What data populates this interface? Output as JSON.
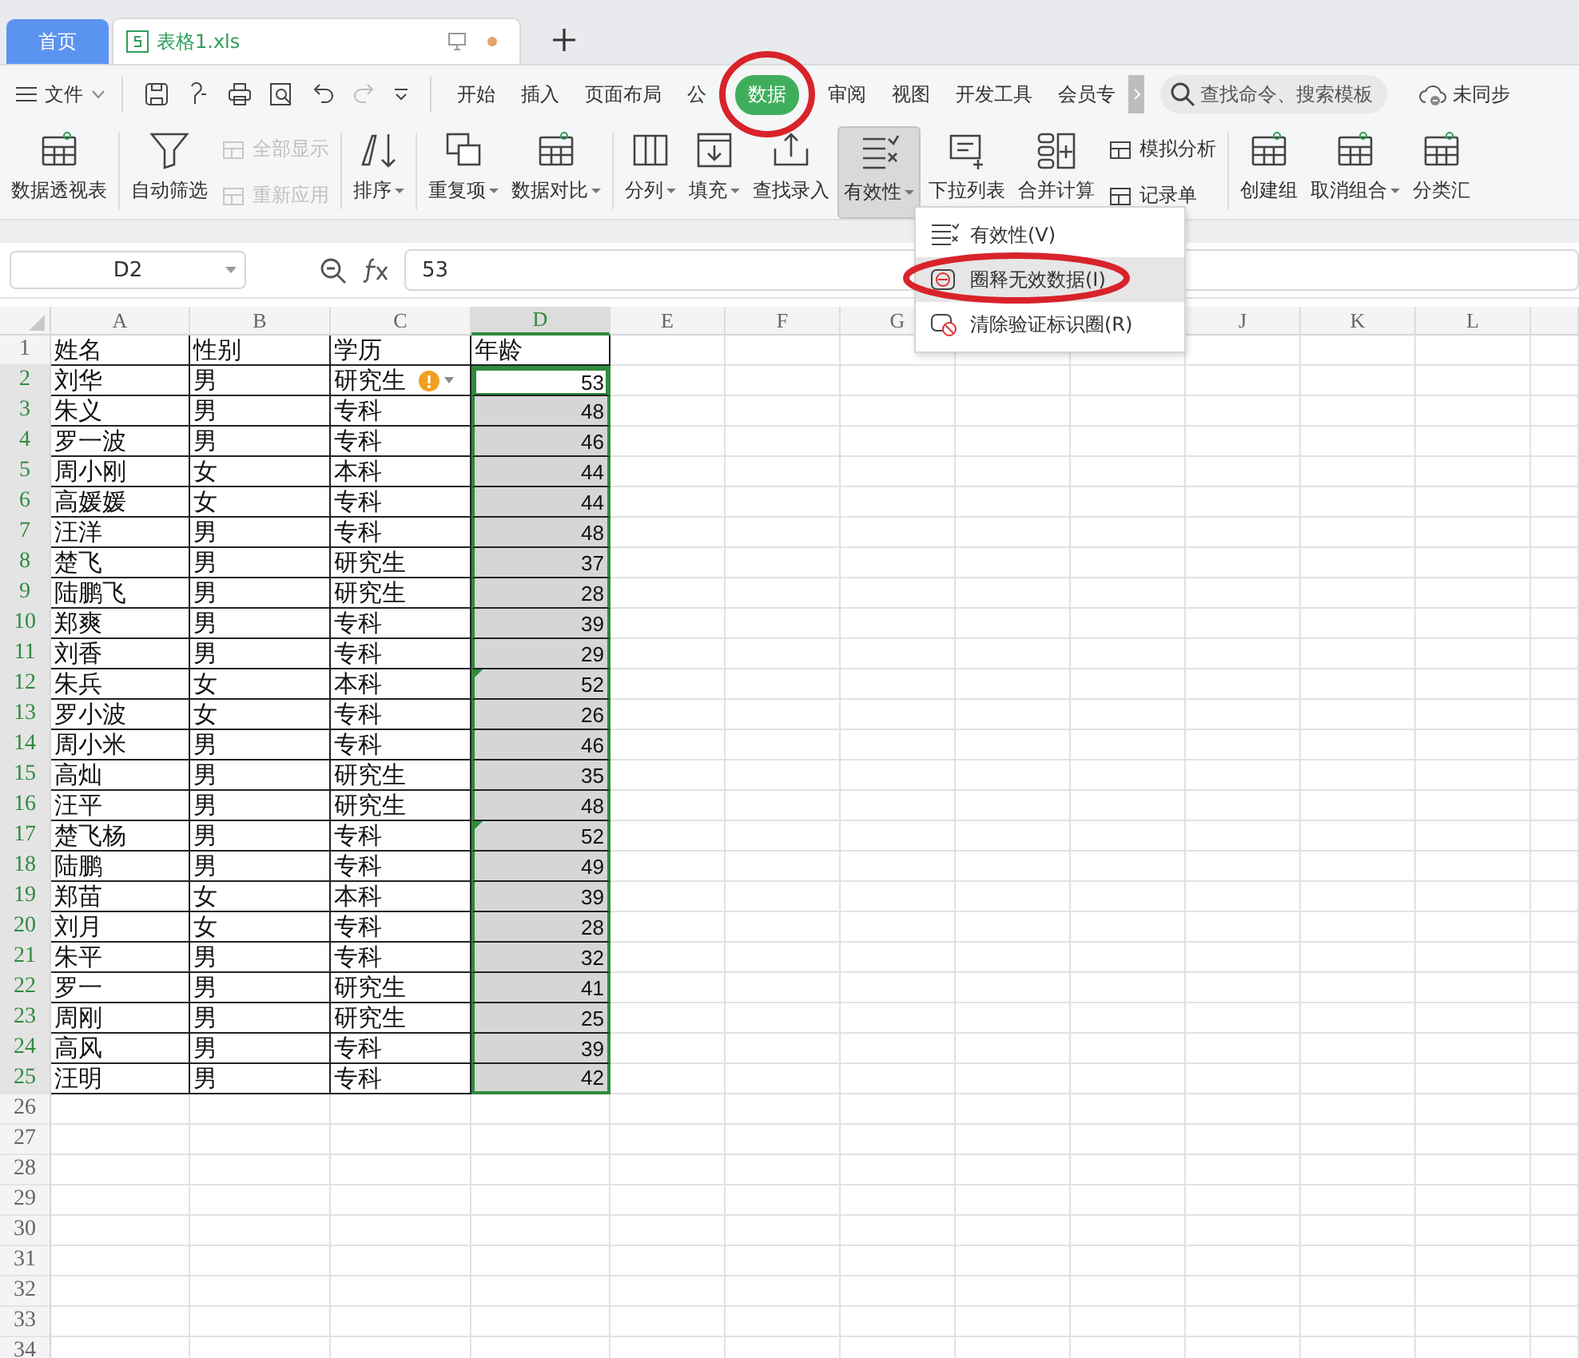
{
  "tabs": [
    {
      "label": "首页",
      "kind": "home",
      "selected": false
    },
    {
      "label": "表格1.xls",
      "kind": "file",
      "selected": true
    }
  ],
  "menu": {
    "file": "文件",
    "tabs": [
      {
        "label": "开始",
        "selected": false
      },
      {
        "label": "插入",
        "selected": false
      },
      {
        "label": "页面布局",
        "selected": false
      },
      {
        "label": "公",
        "selected": false
      },
      {
        "label": "数据",
        "selected": true
      },
      {
        "label": "审阅",
        "selected": false
      },
      {
        "label": "视图",
        "selected": false
      },
      {
        "label": "开发工具",
        "selected": false
      },
      {
        "label": "会员专",
        "selected": false
      }
    ],
    "search": {
      "placeholder": "查找命令、搜索模板"
    },
    "sync": "未同步"
  },
  "ribbon": [
    {
      "items": [
        {
          "kind": "big",
          "label": "数据透视表",
          "dropdown": false,
          "pressed": false
        }
      ]
    },
    {
      "items": [
        {
          "kind": "big",
          "label": "自动筛选",
          "dropdown": false,
          "pressed": false
        },
        {
          "kind": "stack",
          "items": [
            {
              "label": "全部显示",
              "disabled": true
            },
            {
              "label": "重新应用",
              "disabled": true
            }
          ]
        }
      ]
    },
    {
      "items": [
        {
          "kind": "big",
          "label": "排序",
          "dropdown": true,
          "pressed": false
        }
      ]
    },
    {
      "items": [
        {
          "kind": "big",
          "label": "重复项",
          "dropdown": true,
          "pressed": false
        },
        {
          "kind": "big",
          "label": "数据对比",
          "dropdown": true,
          "pressed": false
        }
      ]
    },
    {
      "items": [
        {
          "kind": "big",
          "label": "分列",
          "dropdown": true,
          "pressed": false
        },
        {
          "kind": "big",
          "label": "填充",
          "dropdown": true,
          "pressed": false
        },
        {
          "kind": "big",
          "label": "查找录入",
          "dropdown": false,
          "pressed": false
        },
        {
          "kind": "big",
          "label": "有效性",
          "dropdown": true,
          "pressed": true
        },
        {
          "kind": "big",
          "label": "下拉列表",
          "dropdown": false,
          "pressed": false
        },
        {
          "kind": "big",
          "label": "合并计算",
          "dropdown": false,
          "pressed": false
        },
        {
          "kind": "stack",
          "items": [
            {
              "label": "模拟分析",
              "disabled": false
            },
            {
              "label": "记录单",
              "disabled": false
            }
          ]
        }
      ]
    },
    {
      "items": [
        {
          "kind": "big",
          "label": "创建组",
          "dropdown": false,
          "pressed": false
        },
        {
          "kind": "big",
          "label": "取消组合",
          "dropdown": true,
          "pressed": false
        },
        {
          "kind": "big",
          "label": "分类汇",
          "dropdown": false,
          "pressed": false
        }
      ]
    }
  ],
  "formula_bar": {
    "name_box": "D2",
    "value": "53"
  },
  "menu_popup": [
    {
      "label": "有效性(V)",
      "selected": false
    },
    {
      "label": "圈释无效数据(I)",
      "selected": true
    },
    {
      "label": "清除验证标识圈(R)",
      "selected": false
    }
  ],
  "table": {
    "columns": [
      {
        "label": "A",
        "selected": false
      },
      {
        "label": "B",
        "selected": false
      },
      {
        "label": "C",
        "selected": false
      },
      {
        "label": "D",
        "selected": true
      },
      {
        "label": "E",
        "selected": false
      },
      {
        "label": "F",
        "selected": false
      },
      {
        "label": "G",
        "selected": false
      },
      {
        "label": "J",
        "selected": false
      },
      {
        "label": "K",
        "selected": false
      },
      {
        "label": "L",
        "selected": false
      }
    ],
    "rows": [
      {
        "number": "1",
        "cells": [
          "姓名",
          "性别",
          "学历",
          "年龄"
        ],
        "selected": false,
        "active": false,
        "warning": false,
        "error_mark": false
      },
      {
        "number": "2",
        "cells": [
          "刘华",
          "男",
          "研究生",
          "53"
        ],
        "selected": true,
        "active": true,
        "warning": true,
        "error_mark": false
      },
      {
        "number": "3",
        "cells": [
          "朱义",
          "男",
          "专科",
          "48"
        ],
        "selected": true,
        "active": false,
        "warning": false,
        "error_mark": false
      },
      {
        "number": "4",
        "cells": [
          "罗一波",
          "男",
          "专科",
          "46"
        ],
        "selected": true,
        "active": false,
        "warning": false,
        "error_mark": false
      },
      {
        "number": "5",
        "cells": [
          "周小刚",
          "女",
          "本科",
          "44"
        ],
        "selected": true,
        "active": false,
        "warning": false,
        "error_mark": false
      },
      {
        "number": "6",
        "cells": [
          "高媛媛",
          "女",
          "专科",
          "44"
        ],
        "selected": true,
        "active": false,
        "warning": false,
        "error_mark": false
      },
      {
        "number": "7",
        "cells": [
          "汪洋",
          "男",
          "专科",
          "48"
        ],
        "selected": true,
        "active": false,
        "warning": false,
        "error_mark": false
      },
      {
        "number": "8",
        "cells": [
          "楚飞",
          "男",
          "研究生",
          "37"
        ],
        "selected": true,
        "active": false,
        "warning": false,
        "error_mark": false
      },
      {
        "number": "9",
        "cells": [
          "陆鹏飞",
          "男",
          "研究生",
          "28"
        ],
        "selected": true,
        "active": false,
        "warning": false,
        "error_mark": false
      },
      {
        "number": "10",
        "cells": [
          "郑爽",
          "男",
          "专科",
          "39"
        ],
        "selected": true,
        "active": false,
        "warning": false,
        "error_mark": false
      },
      {
        "number": "11",
        "cells": [
          "刘香",
          "男",
          "专科",
          "29"
        ],
        "selected": true,
        "active": false,
        "warning": false,
        "error_mark": false
      },
      {
        "number": "12",
        "cells": [
          "朱兵",
          "女",
          "本科",
          "52"
        ],
        "selected": true,
        "active": false,
        "warning": false,
        "error_mark": true
      },
      {
        "number": "13",
        "cells": [
          "罗小波",
          "女",
          "专科",
          "26"
        ],
        "selected": true,
        "active": false,
        "warning": false,
        "error_mark": false
      },
      {
        "number": "14",
        "cells": [
          "周小米",
          "男",
          "专科",
          "46"
        ],
        "selected": true,
        "active": false,
        "warning": false,
        "error_mark": false
      },
      {
        "number": "15",
        "cells": [
          "高灿",
          "男",
          "研究生",
          "35"
        ],
        "selected": true,
        "active": false,
        "warning": false,
        "error_mark": false
      },
      {
        "number": "16",
        "cells": [
          "汪平",
          "男",
          "研究生",
          "48"
        ],
        "selected": true,
        "active": false,
        "warning": false,
        "error_mark": false
      },
      {
        "number": "17",
        "cells": [
          "楚飞杨",
          "男",
          "专科",
          "52"
        ],
        "selected": true,
        "active": false,
        "warning": false,
        "error_mark": true
      },
      {
        "number": "18",
        "cells": [
          "陆鹏",
          "男",
          "专科",
          "49"
        ],
        "selected": true,
        "active": false,
        "warning": false,
        "error_mark": false
      },
      {
        "number": "19",
        "cells": [
          "郑苗",
          "女",
          "本科",
          "39"
        ],
        "selected": true,
        "active": false,
        "warning": false,
        "error_mark": false
      },
      {
        "number": "20",
        "cells": [
          "刘月",
          "女",
          "专科",
          "28"
        ],
        "selected": true,
        "active": false,
        "warning": false,
        "error_mark": false
      },
      {
        "number": "21",
        "cells": [
          "朱平",
          "男",
          "专科",
          "32"
        ],
        "selected": true,
        "active": false,
        "warning": false,
        "error_mark": false
      },
      {
        "number": "22",
        "cells": [
          "罗一",
          "男",
          "研究生",
          "41"
        ],
        "selected": true,
        "active": false,
        "warning": false,
        "error_mark": false
      },
      {
        "number": "23",
        "cells": [
          "周刚",
          "男",
          "研究生",
          "25"
        ],
        "selected": true,
        "active": false,
        "warning": false,
        "error_mark": false
      },
      {
        "number": "24",
        "cells": [
          "高风",
          "男",
          "专科",
          "39"
        ],
        "selected": true,
        "active": false,
        "warning": false,
        "error_mark": false
      },
      {
        "number": "25",
        "cells": [
          "汪明",
          "男",
          "专科",
          "42"
        ],
        "selected": true,
        "active": false,
        "warning": false,
        "error_mark": false
      },
      {
        "number": "26"
      },
      {
        "number": "27"
      },
      {
        "number": "28"
      },
      {
        "number": "29"
      },
      {
        "number": "30"
      },
      {
        "number": "31"
      },
      {
        "number": "32"
      },
      {
        "number": "33"
      },
      {
        "number": "34"
      }
    ]
  }
}
